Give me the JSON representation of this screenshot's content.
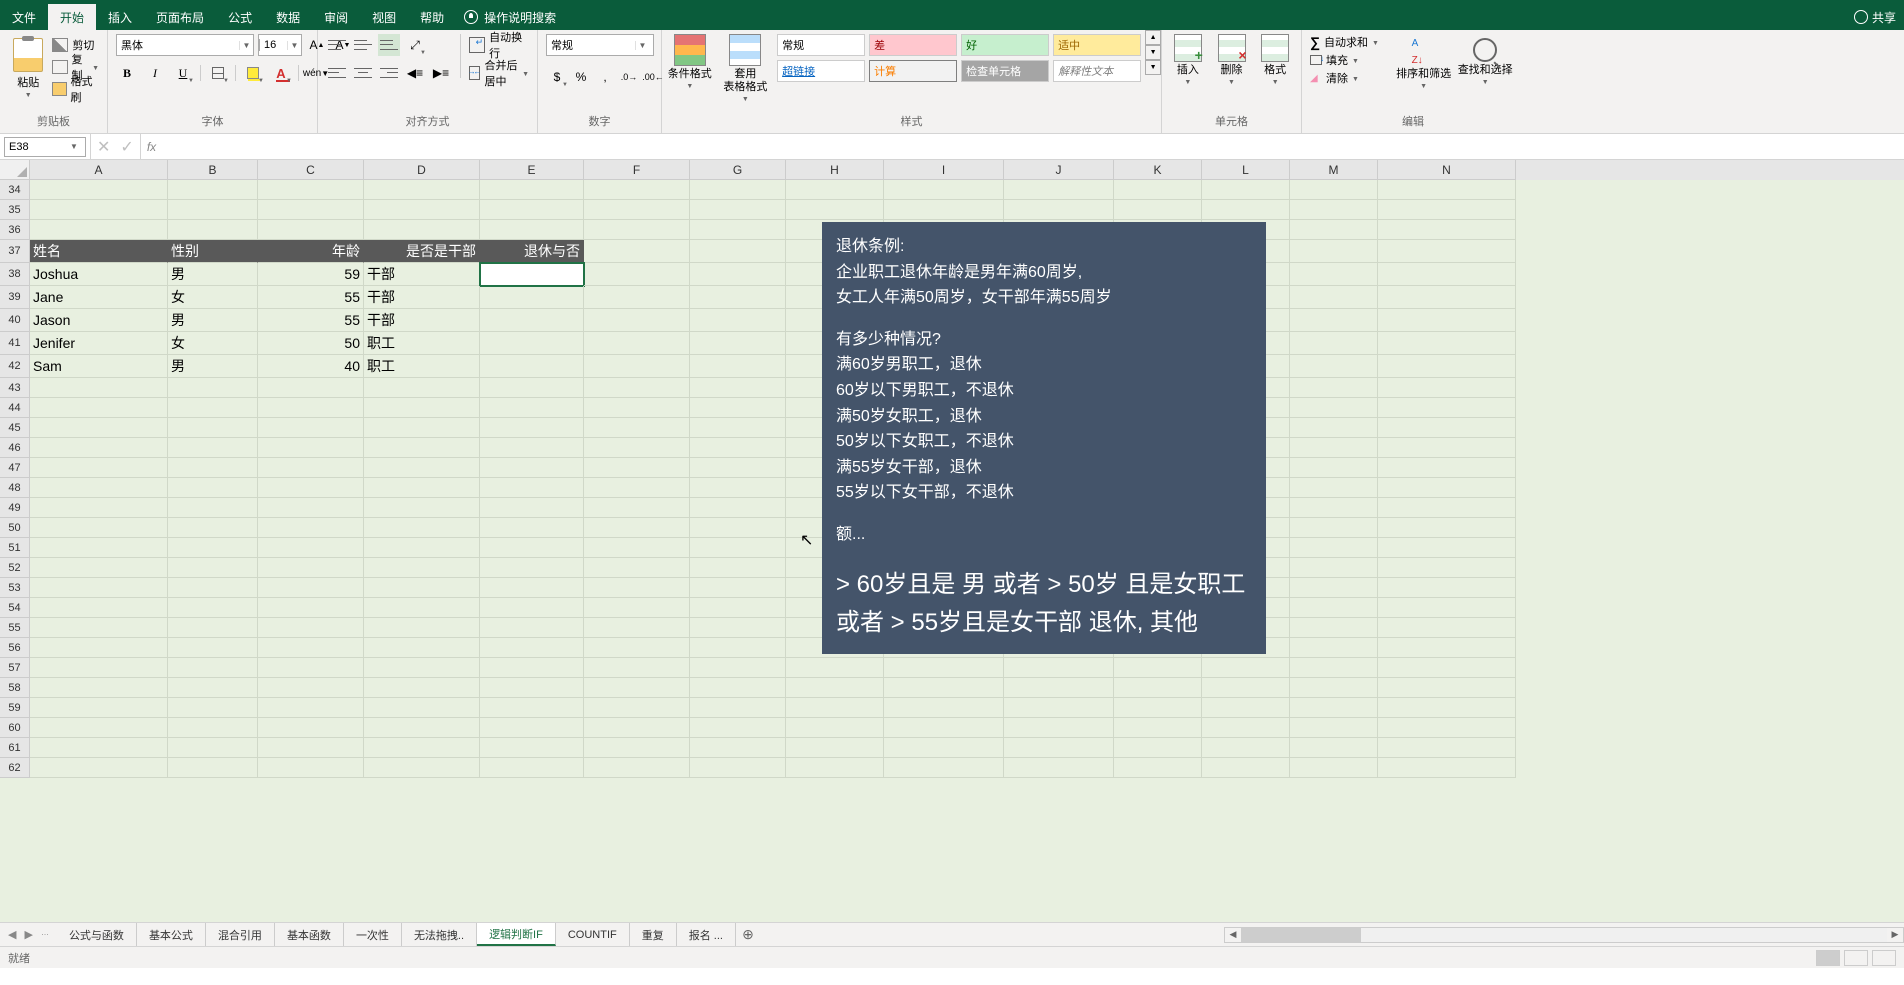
{
  "menu": {
    "file": "文件",
    "home": "开始",
    "insert": "插入",
    "layout": "页面布局",
    "formulas": "公式",
    "data": "数据",
    "review": "审阅",
    "view": "视图",
    "help": "帮助",
    "tellme": "操作说明搜索",
    "share": "共享"
  },
  "ribbon": {
    "clipboard": {
      "label": "剪贴板",
      "paste": "粘贴",
      "cut": "剪切",
      "copy": "复制",
      "painter": "格式刷"
    },
    "font": {
      "label": "字体",
      "name": "黑体",
      "size": "16"
    },
    "align": {
      "label": "对齐方式",
      "wrap": "自动换行",
      "merge": "合并后居中"
    },
    "number": {
      "label": "数字",
      "format": "常规"
    },
    "styles": {
      "label": "样式",
      "condfmt": "条件格式",
      "tablefmt": "套用\n表格格式",
      "normal": "常规",
      "bad": "差",
      "good": "好",
      "neutral": "适中",
      "link": "超链接",
      "calc": "计算",
      "check": "检查单元格",
      "explain": "解释性文本"
    },
    "cells": {
      "label": "单元格",
      "insert": "插入",
      "delete": "删除",
      "format": "格式"
    },
    "editing": {
      "label": "编辑",
      "autosum": "自动求和",
      "fill": "填充",
      "clear": "清除",
      "sort": "排序和筛选",
      "find": "查找和选择"
    }
  },
  "namebox": "E38",
  "formula": "",
  "cols": [
    "A",
    "B",
    "C",
    "D",
    "E",
    "F",
    "G",
    "H",
    "I",
    "J",
    "K",
    "L",
    "M",
    "N"
  ],
  "rowStart": 34,
  "rowEnd": 62,
  "headers": {
    "a": "姓名",
    "b": "性别",
    "c": "年龄",
    "d": "是否是干部",
    "e": "退休与否"
  },
  "data": [
    {
      "a": "Joshua",
      "b": "男",
      "c": "59",
      "d": "干部"
    },
    {
      "a": "Jane",
      "b": "女",
      "c": "55",
      "d": "干部"
    },
    {
      "a": "Jason",
      "b": "男",
      "c": "55",
      "d": "干部"
    },
    {
      "a": "Jenifer",
      "b": "女",
      "c": "50",
      "d": "职工"
    },
    {
      "a": "Sam",
      "b": "男",
      "c": "40",
      "d": "职工"
    }
  ],
  "textbox": {
    "l1": "退休条例:",
    "l2": "企业职工退休年龄是男年满60周岁,",
    "l3": "女工人年满50周岁，女干部年满55周岁",
    "l4": "有多少种情况?",
    "l5": "满60岁男职工，退休",
    "l6": "60岁以下男职工，不退休",
    "l7": "满50岁女职工，退休",
    "l8": "50岁以下女职工，不退休",
    "l9": "满55岁女干部，退休",
    "l10": "55岁以下女干部，不退休",
    "l11": "额...",
    "big": "> 60岁且是 男 或者 > 50岁 且是女职工 或者 > 55岁且是女干部 退休, 其他"
  },
  "sheets": [
    "公式与函数",
    "基本公式",
    "混合引用",
    "基本函数",
    "一次性",
    "无法拖拽..",
    "逻辑判断IF",
    "COUNTIF",
    "重复",
    "报名 ..."
  ],
  "activeSheet": 6,
  "status": "就绪"
}
